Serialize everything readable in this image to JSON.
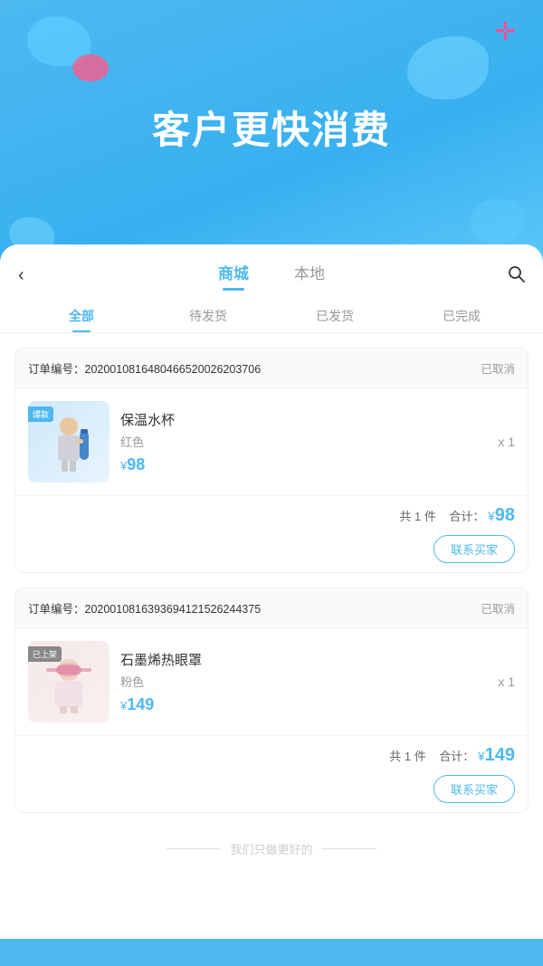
{
  "hero": {
    "title": "客户更快消费",
    "plus_icon": "✛"
  },
  "nav": {
    "back_icon": "‹",
    "tab_mall": "商城",
    "tab_local": "本地",
    "search_icon": "🔍",
    "active_tab": "mall"
  },
  "filters": {
    "all": "全部",
    "pending_ship": "待发货",
    "shipped": "已发货",
    "completed": "已完成",
    "active": "all"
  },
  "orders": [
    {
      "id": "订单编号：2020010816480466520026203706",
      "status": "已取消",
      "product_name": "保温水杯",
      "product_variant": "红色",
      "product_price": "98",
      "product_qty": "x 1",
      "img_label": "爆款",
      "img_label_type": "hot",
      "total_count": "共 1 件",
      "total_label": "合计：",
      "total_yen": "¥",
      "total_price": "98",
      "contact_btn": "联系买家"
    },
    {
      "id": "订单编号：2020010816393694121526244375",
      "status": "已取消",
      "product_name": "石墨烯热眼罩",
      "product_variant": "粉色",
      "product_price": "149",
      "product_qty": "x 1",
      "img_label": "已上架",
      "img_label_type": "listed",
      "total_count": "共 1 件",
      "total_label": "合计：",
      "total_yen": "¥",
      "total_price": "149",
      "contact_btn": "联系买家"
    }
  ],
  "footer": {
    "text": "我们只做更好的"
  }
}
